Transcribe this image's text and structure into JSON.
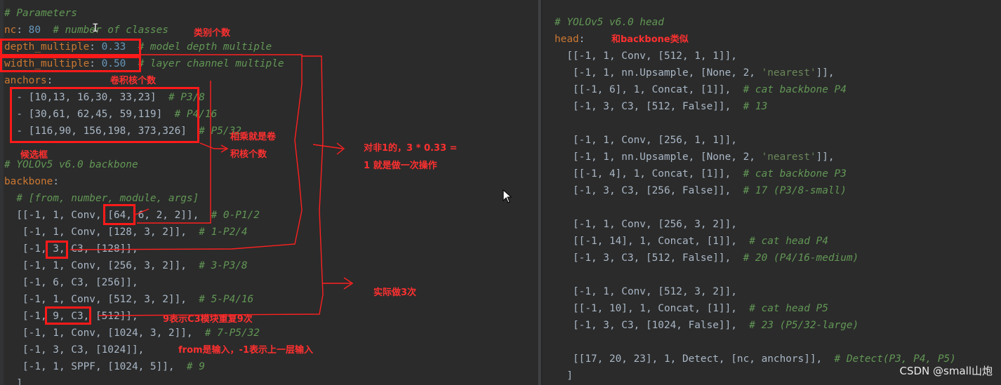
{
  "left_lines": [
    {
      "tokens": [
        {
          "t": "# Parameters",
          "cls": "c"
        }
      ]
    },
    {
      "tokens": [
        {
          "t": "nc",
          "cls": "k"
        },
        {
          "t": ": "
        },
        {
          "t": "80",
          "cls": "n"
        },
        {
          "t": "  "
        },
        {
          "t": "# number of classes",
          "cls": "c"
        }
      ]
    },
    {
      "tokens": [
        {
          "t": "depth_multiple",
          "cls": "k"
        },
        {
          "t": ": "
        },
        {
          "t": "0.33",
          "cls": "n"
        },
        {
          "t": "  "
        },
        {
          "t": "# model depth multiple",
          "cls": "c"
        }
      ]
    },
    {
      "tokens": [
        {
          "t": "width_multiple",
          "cls": "k"
        },
        {
          "t": ": "
        },
        {
          "t": "0.50",
          "cls": "n"
        },
        {
          "t": "  "
        },
        {
          "t": "# layer channel multiple",
          "cls": "c"
        }
      ]
    },
    {
      "tokens": [
        {
          "t": "anchors",
          "cls": "k"
        },
        {
          "t": ":"
        }
      ]
    },
    {
      "tokens": [
        {
          "t": "  - [10,13, 16,30, 33,23]  "
        },
        {
          "t": "# P3/8",
          "cls": "c"
        }
      ]
    },
    {
      "tokens": [
        {
          "t": "  - [30,61, 62,45, 59,119]  "
        },
        {
          "t": "# P4/16",
          "cls": "c"
        }
      ]
    },
    {
      "tokens": [
        {
          "t": "  - [116,90, 156,198, 373,326]  "
        },
        {
          "t": "# P5/32",
          "cls": "c"
        }
      ]
    },
    {
      "tokens": []
    },
    {
      "tokens": [
        {
          "t": "# YOLOv5 v6.0 backbone",
          "cls": "c"
        }
      ]
    },
    {
      "tokens": [
        {
          "t": "backbone",
          "cls": "k"
        },
        {
          "t": ":"
        }
      ]
    },
    {
      "tokens": [
        {
          "t": "  "
        },
        {
          "t": "# [from, number, module, args]",
          "cls": "c"
        }
      ]
    },
    {
      "tokens": [
        {
          "t": "  [[-1, 1, Conv, [64, 6, 2, 2]],  "
        },
        {
          "t": "# 0-P1/2",
          "cls": "c"
        }
      ]
    },
    {
      "tokens": [
        {
          "t": "   [-1, 1, Conv, [128, 3, 2]],  "
        },
        {
          "t": "# 1-P2/4",
          "cls": "c"
        }
      ]
    },
    {
      "tokens": [
        {
          "t": "   [-1, 3, C3, [128]],"
        }
      ]
    },
    {
      "tokens": [
        {
          "t": "   [-1, 1, Conv, [256, 3, 2]],  "
        },
        {
          "t": "# 3-P3/8",
          "cls": "c"
        }
      ]
    },
    {
      "tokens": [
        {
          "t": "   [-1, 6, C3, [256]],"
        }
      ]
    },
    {
      "tokens": [
        {
          "t": "   [-1, 1, Conv, [512, 3, 2]],  "
        },
        {
          "t": "# 5-P4/16",
          "cls": "c"
        }
      ]
    },
    {
      "tokens": [
        {
          "t": "   [-1, 9, C3, [512]],"
        }
      ]
    },
    {
      "tokens": [
        {
          "t": "   [-1, 1, Conv, [1024, 3, 2]],  "
        },
        {
          "t": "# 7-P5/32",
          "cls": "c"
        }
      ]
    },
    {
      "tokens": [
        {
          "t": "   [-1, 3, C3, [1024]],"
        }
      ]
    },
    {
      "tokens": [
        {
          "t": "   [-1, 1, SPPF, [1024, 5]],  "
        },
        {
          "t": "# 9",
          "cls": "c"
        }
      ]
    },
    {
      "tokens": [
        {
          "t": "  ]"
        }
      ]
    }
  ],
  "right_lines": [
    {
      "tokens": [
        {
          "t": "# YOLOv5 v6.0 head",
          "cls": "c"
        }
      ]
    },
    {
      "tokens": [
        {
          "t": "head",
          "cls": "k"
        },
        {
          "t": ":"
        }
      ]
    },
    {
      "tokens": [
        {
          "t": "  [[-1, 1, Conv, [512, 1, 1]],"
        }
      ]
    },
    {
      "tokens": [
        {
          "t": "   [-1, 1, nn.Upsample, [None, 2, "
        },
        {
          "t": "'nearest'",
          "cls": "s"
        },
        {
          "t": "]],"
        }
      ]
    },
    {
      "tokens": [
        {
          "t": "   [[-1, 6], 1, Concat, [1]],  "
        },
        {
          "t": "# cat backbone P4",
          "cls": "c"
        }
      ]
    },
    {
      "tokens": [
        {
          "t": "   [-1, 3, C3, [512, False]],  "
        },
        {
          "t": "# 13",
          "cls": "c"
        }
      ]
    },
    {
      "tokens": []
    },
    {
      "tokens": [
        {
          "t": "   [-1, 1, Conv, [256, 1, 1]],"
        }
      ]
    },
    {
      "tokens": [
        {
          "t": "   [-1, 1, nn.Upsample, [None, 2, "
        },
        {
          "t": "'nearest'",
          "cls": "s"
        },
        {
          "t": "]],"
        }
      ]
    },
    {
      "tokens": [
        {
          "t": "   [[-1, 4], 1, Concat, [1]],  "
        },
        {
          "t": "# cat backbone P3",
          "cls": "c"
        }
      ]
    },
    {
      "tokens": [
        {
          "t": "   [-1, 3, C3, [256, False]],  "
        },
        {
          "t": "# 17 (P3/8-small)",
          "cls": "c"
        }
      ]
    },
    {
      "tokens": []
    },
    {
      "tokens": [
        {
          "t": "   [-1, 1, Conv, [256, 3, 2]],"
        }
      ]
    },
    {
      "tokens": [
        {
          "t": "   [[-1, 14], 1, Concat, [1]],  "
        },
        {
          "t": "# cat head P4",
          "cls": "c"
        }
      ]
    },
    {
      "tokens": [
        {
          "t": "   [-1, 3, C3, [512, False]],  "
        },
        {
          "t": "# 20 (P4/16-medium)",
          "cls": "c"
        }
      ]
    },
    {
      "tokens": []
    },
    {
      "tokens": [
        {
          "t": "   [-1, 1, Conv, [512, 3, 2]],"
        }
      ]
    },
    {
      "tokens": [
        {
          "t": "   [[-1, 10], 1, Concat, [1]],  "
        },
        {
          "t": "# cat head P5",
          "cls": "c"
        }
      ]
    },
    {
      "tokens": [
        {
          "t": "   [-1, 3, C3, [1024, False]],  "
        },
        {
          "t": "# 23 (P5/32-large)",
          "cls": "c"
        }
      ]
    },
    {
      "tokens": []
    },
    {
      "tokens": [
        {
          "t": "   [[17, 20, 23], 1, Detect, [nc, anchors]],  "
        },
        {
          "t": "# Detect(P3, P4, P5)",
          "cls": "c"
        }
      ]
    },
    {
      "tokens": [
        {
          "t": "  ]"
        }
      ]
    }
  ],
  "annotations": {
    "class_count": "类别个数",
    "kernel_count": "卷积核个数",
    "candidate_box": "候选框",
    "multiply_line1": "相乘就是卷",
    "multiply_line2": "积核个数",
    "non1_line1": "对非1的，3 * 0.33 =",
    "non1_line2": "1 就是做一次操作",
    "actual_3": "实际做3次",
    "c3_repeat": "9表示C3模块重复9次",
    "from_input": "from是输入，-1表示上一层输入",
    "head_similar": "和backbone类似"
  },
  "watermark": "CSDN @small山炮",
  "colors": {
    "background": "#2b2b2b",
    "annotation_red": "#ff1a1a",
    "keyword": "#cc7832",
    "comment": "#629755",
    "number": "#6897bb"
  }
}
